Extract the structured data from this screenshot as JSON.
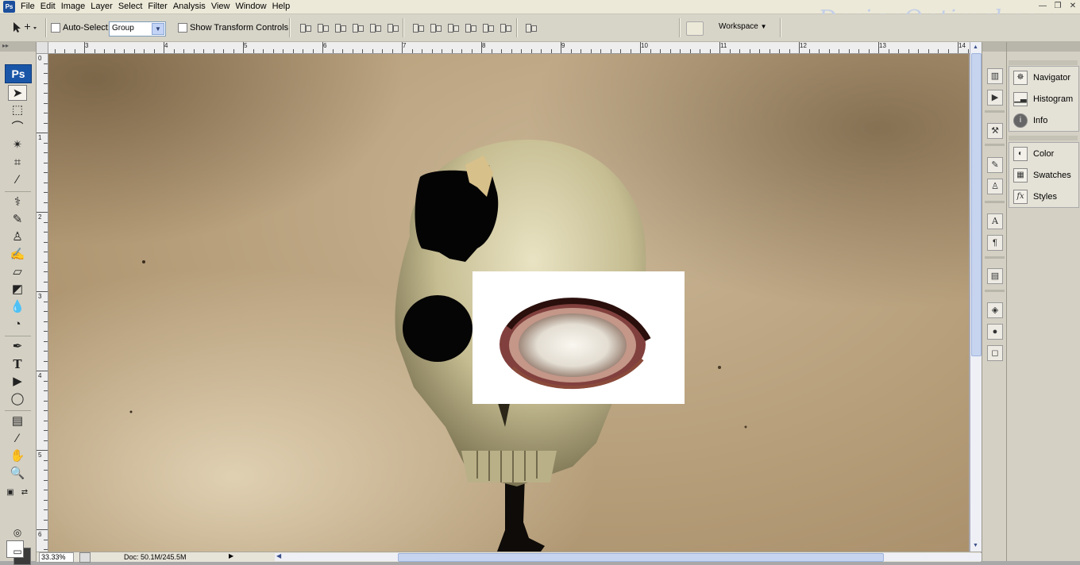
{
  "menubar": {
    "app_icon": "Ps",
    "items": [
      "File",
      "Edit",
      "Image",
      "Layer",
      "Select",
      "Filter",
      "Analysis",
      "View",
      "Window",
      "Help"
    ],
    "watermark": "DesignOptimal.com"
  },
  "options": {
    "auto_select_label": "Auto-Select:",
    "auto_select_value": "Group",
    "show_transform_label": "Show Transform Controls",
    "workspace_label": "Workspace"
  },
  "toolbox": {
    "logo": "Ps",
    "tools": [
      "move-tool",
      "marquee-tool",
      "lasso-tool",
      "magic-wand-tool",
      "crop-tool",
      "eyedropper-tool",
      "healing-brush-tool",
      "brush-tool",
      "clone-stamp-tool",
      "history-brush-tool",
      "eraser-tool",
      "paint-bucket-tool",
      "blur-tool",
      "dodge-tool",
      "pen-tool",
      "type-tool",
      "path-selection-tool",
      "shape-tool",
      "notes-tool",
      "eyedropper-alt-tool",
      "hand-tool",
      "zoom-tool"
    ]
  },
  "rulers": {
    "top_labels": [
      "3",
      "4",
      "5",
      "6",
      "7",
      "8",
      "9",
      "10",
      "11",
      "12",
      "13",
      "14"
    ],
    "left_labels": [
      "0",
      "1",
      "2",
      "3",
      "4",
      "5",
      "6"
    ]
  },
  "status": {
    "zoom": "33.33%",
    "doc": "Doc: 50.1M/245.5M"
  },
  "panels": {
    "group1": [
      "Navigator",
      "Histogram",
      "Info"
    ],
    "group2": [
      "Color",
      "Swatches",
      "Styles"
    ]
  }
}
